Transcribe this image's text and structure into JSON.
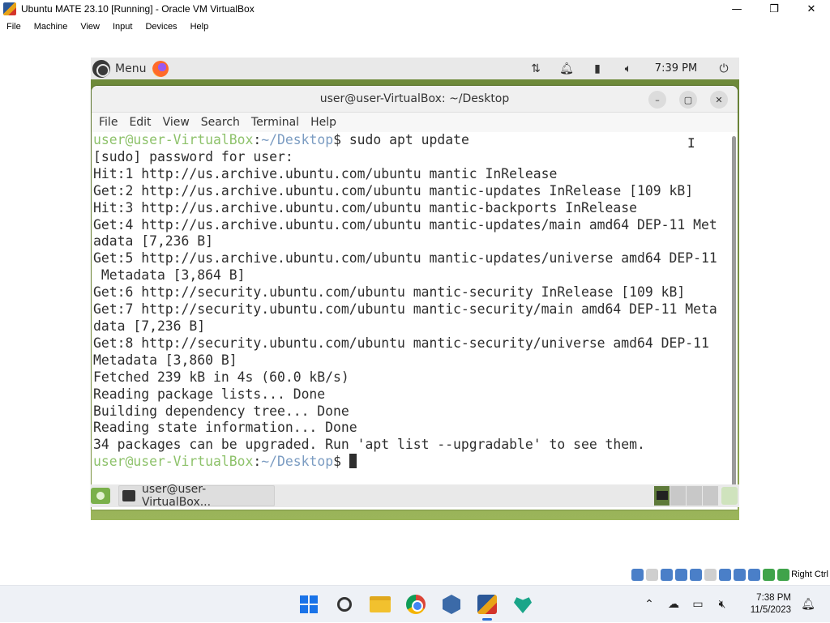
{
  "host_window": {
    "title": "Ubuntu MATE 23.10 [Running] - Oracle VM VirtualBox",
    "controls": {
      "minimize": "—",
      "maximize": "❐",
      "close": "✕"
    },
    "menu": [
      "File",
      "Machine",
      "View",
      "Input",
      "Devices",
      "Help"
    ]
  },
  "mate_top_panel": {
    "menu_label": "Menu",
    "clock": "7:39 PM",
    "icons": [
      "network-icon",
      "notification-bell-icon",
      "battery-icon",
      "volume-icon",
      "power-icon"
    ]
  },
  "terminal": {
    "title": "user@user-VirtualBox: ~/Desktop",
    "menu": [
      "File",
      "Edit",
      "View",
      "Search",
      "Terminal",
      "Help"
    ],
    "prompt": {
      "user": "user@user-VirtualBox",
      "sep": ":",
      "path": "~/Desktop",
      "sym": "$ "
    },
    "command": "sudo apt update",
    "output": [
      "[sudo] password for user:",
      "Hit:1 http://us.archive.ubuntu.com/ubuntu mantic InRelease",
      "Get:2 http://us.archive.ubuntu.com/ubuntu mantic-updates InRelease [109 kB]",
      "Hit:3 http://us.archive.ubuntu.com/ubuntu mantic-backports InRelease",
      "Get:4 http://us.archive.ubuntu.com/ubuntu mantic-updates/main amd64 DEP-11 Met",
      "adata [7,236 B]",
      "Get:5 http://us.archive.ubuntu.com/ubuntu mantic-updates/universe amd64 DEP-11",
      " Metadata [3,864 B]",
      "Get:6 http://security.ubuntu.com/ubuntu mantic-security InRelease [109 kB]",
      "Get:7 http://security.ubuntu.com/ubuntu mantic-security/main amd64 DEP-11 Meta",
      "data [7,236 B]",
      "Get:8 http://security.ubuntu.com/ubuntu mantic-security/universe amd64 DEP-11",
      "Metadata [3,860 B]",
      "Fetched 239 kB in 4s (60.0 kB/s)",
      "Reading package lists... Done",
      "Building dependency tree... Done",
      "Reading state information... Done",
      "34 packages can be upgraded. Run 'apt list --upgradable' to see them."
    ]
  },
  "mate_bottom_panel": {
    "task_label": "user@user-VirtualBox..."
  },
  "vb_status": {
    "host_key": "Right Ctrl"
  },
  "win_taskbar": {
    "clock_time": "7:38 PM",
    "clock_date": "11/5/2023"
  }
}
